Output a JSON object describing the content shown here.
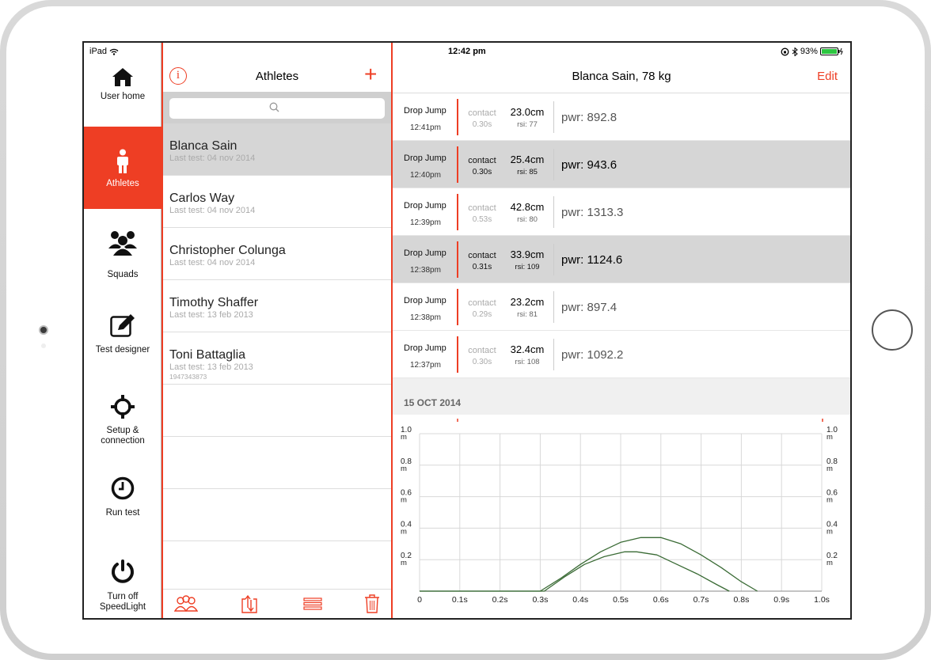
{
  "status": {
    "device": "iPad",
    "time": "12:42 pm",
    "battery": "93%"
  },
  "sidebar": {
    "items": [
      {
        "label": "User home",
        "icon": "home-icon"
      },
      {
        "label": "Athletes",
        "icon": "person-icon",
        "active": true
      },
      {
        "label": "Squads",
        "icon": "group-icon"
      },
      {
        "label": "Test designer",
        "icon": "edit-icon"
      },
      {
        "label": "Setup & connection",
        "icon": "crosshair-icon"
      },
      {
        "label": "Run test",
        "icon": "timer-icon"
      },
      {
        "label": "Turn off SpeedLight",
        "icon": "power-icon"
      }
    ]
  },
  "athletes_panel": {
    "title": "Athletes",
    "search_placeholder": "",
    "athletes": [
      {
        "name": "Blanca Sain",
        "last_test": "Last test: 04 nov 2014",
        "selected": true
      },
      {
        "name": "Carlos Way",
        "last_test": "Last test: 04 nov 2014"
      },
      {
        "name": "Christopher Colunga",
        "last_test": "Last test: 04 nov 2014"
      },
      {
        "name": "Timothy Shaffer",
        "last_test": "Last test: 13 feb 2013"
      },
      {
        "name": "Toni Battaglia",
        "last_test": "Last test: 13 feb 2013",
        "extra": "1947343873"
      }
    ]
  },
  "detail": {
    "title": "Blanca Sain, 78 kg",
    "edit_label": "Edit",
    "results": [
      {
        "test": "Drop Jump",
        "time": "12:41pm",
        "contact": "contact",
        "contact_time": "0.30s",
        "height": "23.0cm",
        "rsi": "rsi: 77",
        "power": "pwr: 892.8",
        "highlighted": false
      },
      {
        "test": "Drop Jump",
        "time": "12:40pm",
        "contact": "contact",
        "contact_time": "0.30s",
        "height": "25.4cm",
        "rsi": "rsi: 85",
        "power": "pwr: 943.6",
        "highlighted": true
      },
      {
        "test": "Drop Jump",
        "time": "12:39pm",
        "contact": "contact",
        "contact_time": "0.53s",
        "height": "42.8cm",
        "rsi": "rsi: 80",
        "power": "pwr: 1313.3",
        "highlighted": false
      },
      {
        "test": "Drop Jump",
        "time": "12:38pm",
        "contact": "contact",
        "contact_time": "0.31s",
        "height": "33.9cm",
        "rsi": "rsi: 109",
        "power": "pwr: 1124.6",
        "highlighted": true
      },
      {
        "test": "Drop Jump",
        "time": "12:38pm",
        "contact": "contact",
        "contact_time": "0.29s",
        "height": "23.2cm",
        "rsi": "rsi: 81",
        "power": "pwr: 897.4",
        "highlighted": false
      },
      {
        "test": "Drop Jump",
        "time": "12:37pm",
        "contact": "contact",
        "contact_time": "0.30s",
        "height": "32.4cm",
        "rsi": "rsi: 108",
        "power": "pwr: 1092.2",
        "highlighted": false
      }
    ],
    "date_section": "15 OCT 2014"
  },
  "chart_data": {
    "type": "line",
    "x_ticks": [
      "0",
      "0.1s",
      "0.2s",
      "0.3s",
      "0.4s",
      "0.5s",
      "0.6s",
      "0.7s",
      "0.8s",
      "0.9s",
      "1.0s"
    ],
    "y_ticks": [
      "0.2",
      "0.4",
      "0.6",
      "0.8",
      "1.0"
    ],
    "y_unit": "m",
    "xlim": [
      0,
      1.0
    ],
    "ylim": [
      0,
      1.0
    ],
    "grid": true,
    "color": "#3a6b35",
    "series": [
      {
        "x": [
          0,
          0.3,
          0.35,
          0.4,
          0.45,
          0.5,
          0.55,
          0.6,
          0.65,
          0.7,
          0.75,
          0.8,
          0.84
        ],
        "y": [
          0,
          0,
          0.08,
          0.17,
          0.25,
          0.31,
          0.34,
          0.34,
          0.3,
          0.23,
          0.15,
          0.06,
          0
        ]
      },
      {
        "x": [
          0,
          0.31,
          0.36,
          0.41,
          0.46,
          0.51,
          0.54,
          0.59,
          0.64,
          0.69,
          0.74,
          0.77
        ],
        "y": [
          0,
          0,
          0.09,
          0.17,
          0.22,
          0.25,
          0.25,
          0.23,
          0.17,
          0.11,
          0.04,
          0
        ]
      }
    ]
  }
}
